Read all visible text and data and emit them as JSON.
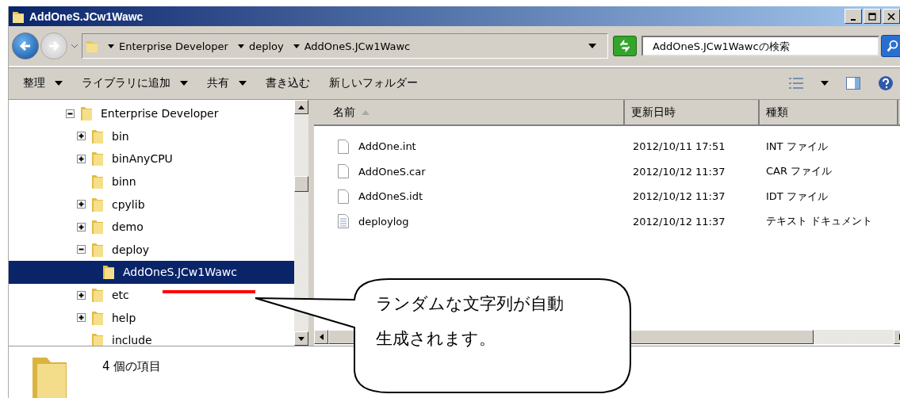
{
  "window": {
    "title": "AddOneS.JCw1Wawc"
  },
  "address_bar": {
    "breadcrumb": [
      "Enterprise Developer",
      "deploy",
      "AddOneS.JCw1Wawc"
    ]
  },
  "search": {
    "placeholder": "AddOneS.JCw1Wawcの検索"
  },
  "toolbar": [
    {
      "label": "整理",
      "dropdown": true
    },
    {
      "label": "ライブラリに追加",
      "dropdown": true
    },
    {
      "label": "共有",
      "dropdown": true
    },
    {
      "label": "書き込む",
      "dropdown": false
    },
    {
      "label": "新しいフォルダー",
      "dropdown": false
    }
  ],
  "tree": [
    {
      "label": "Enterprise Developer",
      "expanded": true,
      "selected": false,
      "children": [
        {
          "label": "bin",
          "expanded": false,
          "selected": false
        },
        {
          "label": "binAnyCPU",
          "expanded": false,
          "selected": false
        },
        {
          "label": "binn",
          "selected": false
        },
        {
          "label": "cpylib",
          "expanded": false,
          "selected": false
        },
        {
          "label": "demo",
          "expanded": false,
          "selected": false
        },
        {
          "label": "deploy",
          "expanded": true,
          "selected": false,
          "children": [
            {
              "label": "AddOneS.JCw1Wawc",
              "selected": true
            }
          ]
        },
        {
          "label": "etc",
          "expanded": false,
          "selected": false
        },
        {
          "label": "help",
          "expanded": false,
          "selected": false
        },
        {
          "label": "include",
          "selected": false
        }
      ]
    }
  ],
  "table": {
    "columns": [
      "名前",
      "更新日時",
      "種類"
    ],
    "rows": [
      {
        "name": "AddOne.int",
        "modified": "2012/10/11 17:51",
        "type": "INT ファイル",
        "kind": "file"
      },
      {
        "name": "AddOneS.car",
        "modified": "2012/10/12 11:37",
        "type": "CAR ファイル",
        "kind": "file"
      },
      {
        "name": "AddOneS.idt",
        "modified": "2012/10/12 11:37",
        "type": "IDT ファイル",
        "kind": "file"
      },
      {
        "name": "deploylog",
        "modified": "2012/10/12 11:37",
        "type": "テキスト ドキュメント",
        "kind": "text"
      }
    ]
  },
  "status_bar": {
    "text": "4 個の項目"
  },
  "callout": {
    "lines": [
      "ランダムな文字列が自動",
      "生成されます。"
    ]
  }
}
